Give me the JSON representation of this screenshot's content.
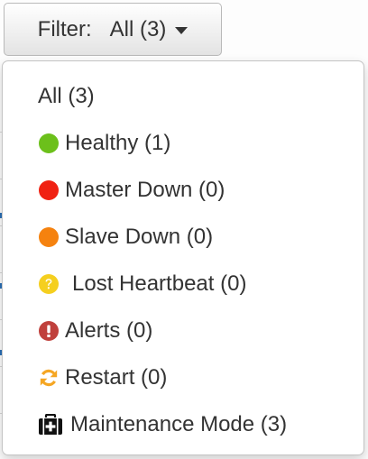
{
  "filter_button": {
    "prefix": "Filter:",
    "value": "All (3)"
  },
  "menu": {
    "items": [
      {
        "label": "All (3)",
        "icon": "none"
      },
      {
        "label": "Healthy (1)",
        "icon": "green-dot-icon",
        "color": "#6cc01b"
      },
      {
        "label": "Master Down (0)",
        "icon": "red-dot-icon",
        "color": "#f02112"
      },
      {
        "label": "Slave Down (0)",
        "icon": "orange-dot-icon",
        "color": "#f5820f"
      },
      {
        "label": "Lost Heartbeat (0)",
        "icon": "question-circle-icon",
        "color": "#f5cf1f"
      },
      {
        "label": "Alerts (0)",
        "icon": "exclamation-circle-icon",
        "color": "#c0403c"
      },
      {
        "label": "Restart (0)",
        "icon": "refresh-icon",
        "color": "#f5a623"
      },
      {
        "label": "Maintenance Mode (3)",
        "icon": "medkit-icon",
        "color": "#111111"
      }
    ]
  }
}
